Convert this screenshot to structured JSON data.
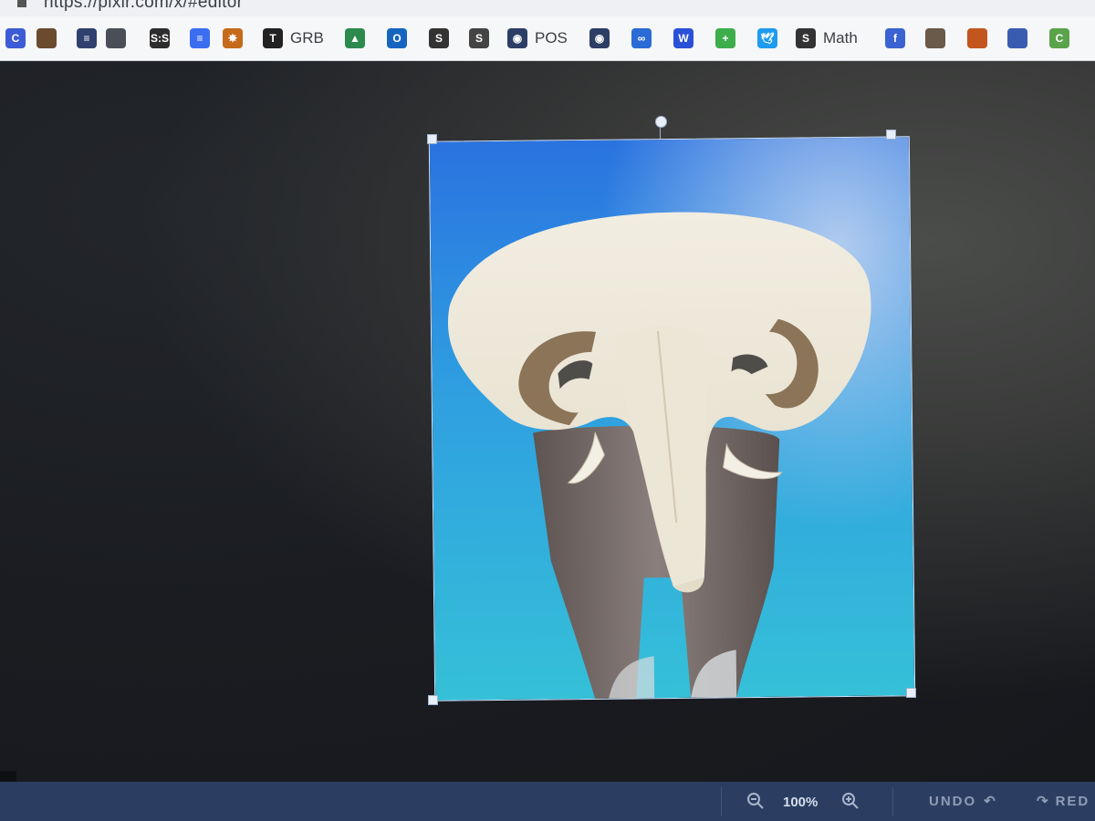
{
  "browser": {
    "url": "https://pixlr.com/x/#editor"
  },
  "bookmarks": [
    {
      "icon": "c-icon",
      "label": "",
      "color": "#3c5bd6",
      "glyph": "C"
    },
    {
      "icon": "book-icon",
      "label": "",
      "color": "#6b4a2e",
      "glyph": ""
    },
    {
      "icon": "list-icon",
      "label": "",
      "color": "#2f3f6e",
      "glyph": "≡"
    },
    {
      "icon": "notebook-icon",
      "label": "",
      "color": "#4a4f57",
      "glyph": ""
    },
    {
      "icon": "sis-icon",
      "label": "",
      "color": "#2d2d2d",
      "glyph": "S:S"
    },
    {
      "icon": "docs-icon",
      "label": "",
      "color": "#3b6df0",
      "glyph": "≡"
    },
    {
      "icon": "burst-icon",
      "label": "",
      "color": "#c56a1a",
      "glyph": "✸"
    },
    {
      "icon": "grb-icon",
      "label": "GRB",
      "color": "#222",
      "glyph": "T"
    },
    {
      "icon": "drive-icon",
      "label": "",
      "color": "#2d8a4e",
      "glyph": "▲"
    },
    {
      "icon": "outlook-icon",
      "label": "",
      "color": "#1565c0",
      "glyph": "O"
    },
    {
      "icon": "s-icon",
      "label": "",
      "color": "#333",
      "glyph": "S"
    },
    {
      "icon": "sj-icon",
      "label": "",
      "color": "#444",
      "glyph": "S"
    },
    {
      "icon": "eye-icon",
      "label": "POS",
      "color": "#2c3e66",
      "glyph": "◉"
    },
    {
      "icon": "eye-icon",
      "label": "",
      "color": "#2c3e66",
      "glyph": "◉"
    },
    {
      "icon": "link-icon",
      "label": "",
      "color": "#2b6bd6",
      "glyph": "∞"
    },
    {
      "icon": "w-icon",
      "label": "",
      "color": "#2a50d8",
      "glyph": "W"
    },
    {
      "icon": "plus-circle-icon",
      "label": "",
      "color": "#3cae4a",
      "glyph": "+"
    },
    {
      "icon": "twitter-icon",
      "label": "",
      "color": "#1d9bf0",
      "glyph": "🕊"
    },
    {
      "icon": "math-icon",
      "label": "Math",
      "color": "#333",
      "glyph": "S"
    },
    {
      "icon": "facebook-icon",
      "label": "",
      "color": "#3b63d1",
      "glyph": "f"
    },
    {
      "icon": "layout-icon",
      "label": "",
      "color": "#6a5a4a",
      "glyph": ""
    },
    {
      "icon": "slides-icon",
      "label": "",
      "color": "#c3561e",
      "glyph": ""
    },
    {
      "icon": "book2-icon",
      "label": "",
      "color": "#3a5cb0",
      "glyph": ""
    },
    {
      "icon": "c2-icon",
      "label": "",
      "color": "#5aa34a",
      "glyph": "C"
    }
  ],
  "canvas": {
    "background_top": "#2a73e0",
    "background_bottom": "#35c0d8"
  },
  "toolbar": {
    "zoom_label": "100%",
    "undo_label": "UNDO",
    "redo_label": "RED"
  }
}
